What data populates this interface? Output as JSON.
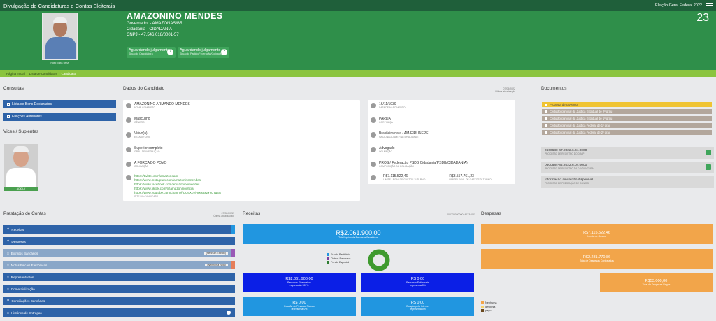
{
  "topbar": {
    "title": "Divulgação de Candidaturas e Contas Eleitorais",
    "election": "Eleição Geral Federal 2022"
  },
  "candidate": {
    "name": "AMAZONINO MENDES",
    "office": "Governador - AMAZONAS/BR",
    "city": "Cidadania - CIDADANIA",
    "cnpj": "CNPJ - 47.546.018/0001-57",
    "number": "23",
    "photo_caption": "Foto para urna",
    "status1": {
      "title": "Aguardando julgamento",
      "sub": "Situação Candidatura"
    },
    "status2": {
      "title": "Aguardando julgamento",
      "sub": "Situação Partido/Federação/Coligação"
    }
  },
  "breadcrumb": [
    "Página Inicial",
    "Lista de Candidatos",
    "Candidato"
  ],
  "consultas": {
    "title": "Consultas",
    "items": [
      "Lista de Bens Declarados",
      "Eleições Anteriores"
    ]
  },
  "vices": {
    "title": "Vices / Suplentes",
    "label": "ACIOLY"
  },
  "dados": {
    "title": "Dados do Candidato",
    "updated": "07/08/2022",
    "updated_label": "Última atualização",
    "left": [
      {
        "v": "AMAZONINO ARMANDO MENDES",
        "l": "NOME COMPLETO"
      },
      {
        "v": "Masculino",
        "l": "GÊNERO"
      },
      {
        "v": "Viúvo(a)",
        "l": "ESTADO CIVIL"
      },
      {
        "v": "Superior completo",
        "l": "GRAU DE INSTRUÇÃO"
      },
      {
        "v": "A FORÇA DO POVO",
        "l": "COLIGAÇÃO"
      }
    ],
    "links": [
      "https://twitter.com/amazonoam",
      "https://www.instagram.com/amazoninomendes",
      "https://www.facebook.com/amazoninomendes",
      "https://www.tiktok.com/@amazoninooficial",
      "https://www.youtube.com/channel/UCeXbYi-8KxJx2Yk0Tq4A"
    ],
    "links_label": "SITE DO CANDIDATO",
    "right": [
      {
        "v": "16/11/1939",
        "l": "DATA DE NASCIMENTO"
      },
      {
        "v": "PARDA",
        "l": "COR / RAÇA"
      },
      {
        "v": "Brasileira nata / AM-EIRUNEPÉ",
        "l": "NACIONALIDADE / NATURALIDADE"
      },
      {
        "v": "Advogado",
        "l": "OCUPAÇÃO"
      },
      {
        "v": "PROS / Federação PSDB Cidadania(PSDB/CIDADANIA)",
        "l": "COMPOSIÇÃO DA COLIGAÇÃO"
      }
    ],
    "limit1": {
      "v": "R$7.115.522,46",
      "l": "LIMITE LEGAL DE GASTOS 1º TURNO"
    },
    "limit2": {
      "v": "R$3.557.761,23",
      "l": "LIMITE LEGAL DE GASTOS 2º TURNO"
    }
  },
  "documentos": {
    "title": "Documentos",
    "items": [
      "Proposta de Governo",
      "Certidão criminal da Justiça Estadual de 2º grau",
      "Certidão criminal da Justiça Estadual de 1º grau",
      "Certidão criminal da Justiça Federal de 1º grau",
      "Certidão criminal da Justiça Federal de 2º grau"
    ],
    "proc1": {
      "v": "0600680-47.2022.6.04.0000",
      "l": "PROCESSO DE REGISTRO DO DRAP"
    },
    "proc2": {
      "v": "0600684-84.2022.6.04.0000",
      "l": "PROCESSO DE REGISTRO DA CANDIDATURA"
    },
    "proc3": {
      "v": "Informação ainda não disponível",
      "l": "PROCESSO DE PRESTAÇÃO DE CONTAS"
    }
  },
  "prestacao": {
    "title": "Prestação de Contas",
    "updated": "07/08/2022",
    "updated_label": "Última atualização",
    "items": [
      {
        "label": "Receitas",
        "tag": ""
      },
      {
        "label": "Despesas",
        "tag": ""
      },
      {
        "label": "Extratos Bancários",
        "tag": "(Nenhum Extrato)"
      },
      {
        "label": "Notas Fiscais Eletrônicas",
        "tag": "(Nenhuma Nota)"
      },
      {
        "label": "Representantes",
        "tag": ""
      },
      {
        "label": "Comercialização",
        "tag": ""
      },
      {
        "label": "Conciliações Bancárias",
        "tag": ""
      },
      {
        "label": "Histórico de Entregas",
        "tag": ""
      }
    ]
  },
  "receitas": {
    "title": "Receitas",
    "code": "000230000000441334061",
    "total": {
      "v": "R$2.061.900,00",
      "l": "Total líquido de Recursos Recebidos"
    },
    "legend": [
      {
        "name": "Fundo Partidário",
        "color": "#2196e0"
      },
      {
        "name": "Outros Recursos",
        "color": "#7b3fa0"
      },
      {
        "name": "Fundo Especial",
        "color": "#2e7d32"
      }
    ],
    "box1": {
      "v": "R$2.061.900,00",
      "l1": "Recursos Financeiros",
      "l2": "representa 100%"
    },
    "box2": {
      "v": "R$ 0,00",
      "l1": "Recursos Estimáveis",
      "l2": "representa 0%"
    },
    "box3": {
      "v": "R$ 0,00",
      "l1": "Doação de Pessoas Físicas",
      "l2": "representa 0%"
    },
    "box4": {
      "v": "R$ 0,00",
      "l1": "Doação pela Internet",
      "l2": "representa 0%"
    }
  },
  "despesas": {
    "title": "Despesas",
    "limit": {
      "v": "R$7.115.522,46",
      "l": "Limite de Gastos"
    },
    "contracted": {
      "v": "R$2.231.770,86",
      "l": "Total de Despesas Contratadas"
    },
    "paid": {
      "v": "R$53.000,00",
      "l": "Total de Despesas Pagas"
    },
    "legend": [
      {
        "name": "Nenhuma",
        "color": "#f2a54a"
      },
      {
        "name": "despesa",
        "color": "#f5d36b"
      },
      {
        "name": "pago",
        "color": "#6b4a1f"
      }
    ]
  }
}
